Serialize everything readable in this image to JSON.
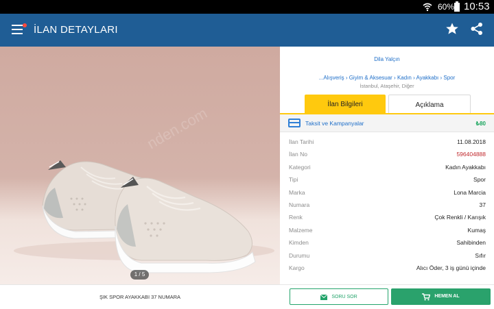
{
  "status_bar": {
    "battery": "60%",
    "time": "10:53"
  },
  "app_bar": {
    "title": "İLAN DETAYLARI"
  },
  "photo": {
    "pager": "1 / 5"
  },
  "listing": {
    "seller": "Dila Yalçın",
    "breadcrumb": "...Alışveriş › Giyim & Aksesuar › Kadın › Ayakkabı › Spor",
    "location": "İstanbul, Ataşehir, Diğer"
  },
  "tabs": [
    {
      "label": "İlan Bilgileri",
      "active": true
    },
    {
      "label": "Açıklama",
      "active": false
    }
  ],
  "promo": {
    "label": "Taksit ve Kampanyalar",
    "badge": "₺80"
  },
  "details": [
    {
      "key": "İlan Tarihi",
      "value": "11.08.2018"
    },
    {
      "key": "İlan No",
      "value": "596404888"
    },
    {
      "key": "Kategori",
      "value": "Kadın Ayakkabı"
    },
    {
      "key": "Tipi",
      "value": "Spor"
    },
    {
      "key": "Marka",
      "value": "Lona Marcia"
    },
    {
      "key": "Numara",
      "value": "37"
    },
    {
      "key": "Renk",
      "value": "Çok Renkli / Karışık"
    },
    {
      "key": "Malzeme",
      "value": "Kumaş"
    },
    {
      "key": "Kimden",
      "value": "Sahibinden"
    },
    {
      "key": "Durumu",
      "value": "Sıfır"
    },
    {
      "key": "Kargo",
      "value": "Alıcı Öder, 3 iş günü içinde"
    }
  ],
  "bottom": {
    "product_title": "ŞIK SPOR AYAKKABI 37 NUMARA",
    "ask_label": "SORU SOR",
    "buy_label": "HEMEN AL"
  },
  "colors": {
    "app_bar": "#1f5d95",
    "tab_active": "#ffc90e",
    "accent_green": "#2aa26c",
    "link_blue": "#1e6ec8",
    "listing_no_red": "#c0282c"
  },
  "icons": [
    "wifi-icon",
    "battery-icon",
    "menu-icon",
    "star-icon",
    "share-icon",
    "credit-card-icon",
    "mail-icon",
    "cart-icon"
  ]
}
